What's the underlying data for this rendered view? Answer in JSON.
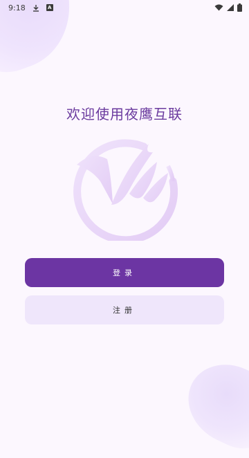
{
  "status_bar": {
    "time": "9:18",
    "download_icon": "download-icon",
    "notification_badge": "A",
    "wifi_icon": "wifi-icon",
    "signal_icon": "signal-icon",
    "battery_icon": "battery-icon"
  },
  "welcome": {
    "title": "欢迎使用夜鹰互联"
  },
  "logo": {
    "icon": "nighthawk-logo",
    "color": "#e6d3f7"
  },
  "actions": {
    "login_label": "登录",
    "register_label": "注册"
  },
  "colors": {
    "primary": "#6c35a3",
    "secondary": "#efe6fb",
    "title": "#6a3a9e",
    "background": "#fcf7fe"
  }
}
